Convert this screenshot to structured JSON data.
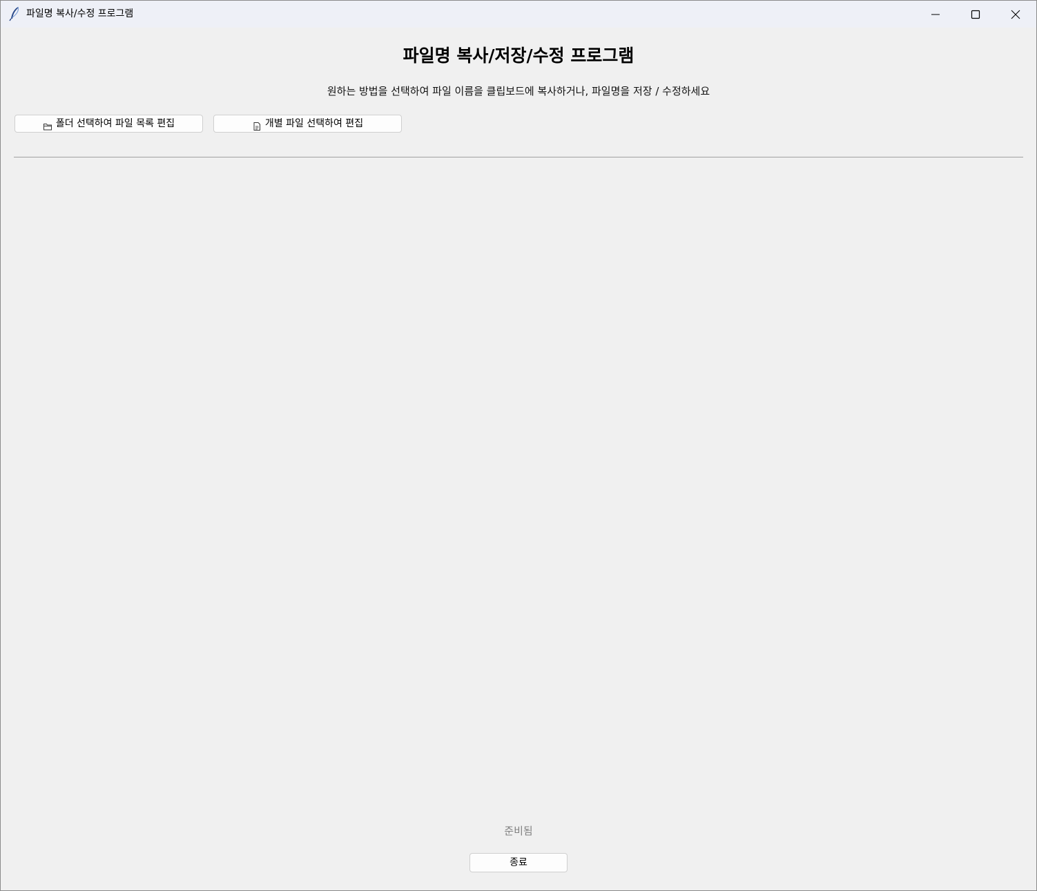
{
  "window": {
    "title": "파일명 복사/수정 프로그램",
    "app_icon": "feather-icon",
    "controls": {
      "minimize_icon": "minimize-icon",
      "maximize_icon": "maximize-icon",
      "close_icon": "close-icon"
    }
  },
  "main": {
    "heading": "파일명 복사/저장/수정 프로그램",
    "description": "원하는 방법을 선택하여 파일 이름을 클립보드에 복사하거나, 파일명을 저장 / 수정하세요",
    "buttons": {
      "folder_label": "폴더 선택하여 파일 목록 편집",
      "folder_icon": "folder-icon",
      "file_label": "개별 파일 선택하여 편집",
      "file_icon": "file-icon"
    }
  },
  "footer": {
    "status": "준비됨",
    "exit_label": "종료"
  },
  "colors": {
    "background": "#f0f0f0",
    "titlebar": "#eef0f7",
    "status_text": "#808080"
  }
}
